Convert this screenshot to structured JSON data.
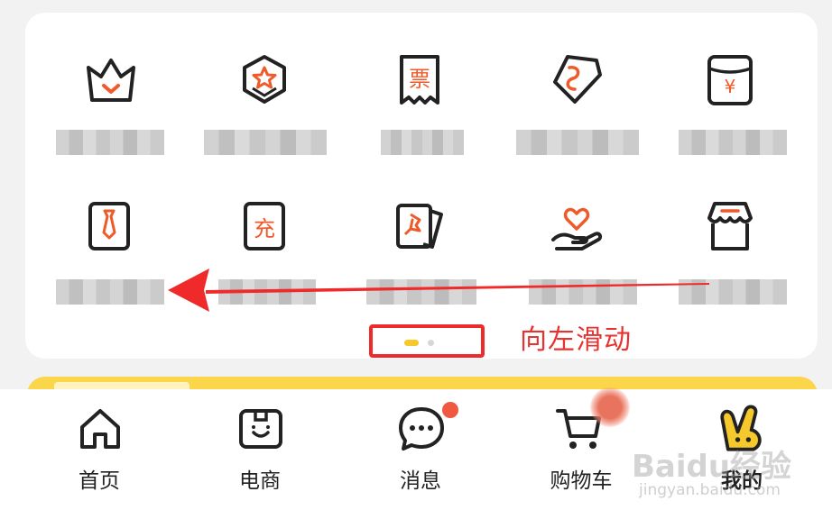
{
  "colors": {
    "accent_orange": "#ef5a2a",
    "icon_stroke": "#222222",
    "annotation_red": "#f02a2a",
    "pager_active": "#f5c92c",
    "pager_inactive": "#d6d6d6",
    "banner_yellow": "#fbd54a",
    "badge_red": "#f0593f"
  },
  "grid": {
    "items": [
      {
        "icon": "crown-icon"
      },
      {
        "icon": "star-badge-icon"
      },
      {
        "icon": "ticket-icon",
        "glyph": "票"
      },
      {
        "icon": "coupon-tag-icon"
      },
      {
        "icon": "red-envelope-icon",
        "glyph": "¥"
      },
      {
        "icon": "uniform-tie-icon"
      },
      {
        "icon": "recharge-icon",
        "glyph": "充"
      },
      {
        "icon": "pinned-cards-icon"
      },
      {
        "icon": "heart-hand-icon"
      },
      {
        "icon": "storefront-icon"
      }
    ]
  },
  "pager": {
    "pages": 2,
    "current": 1
  },
  "annotation": {
    "hint_text": "向左滑动"
  },
  "tabbar": {
    "tabs": [
      {
        "label": "首页",
        "icon": "home-icon"
      },
      {
        "label": "电商",
        "icon": "shop-box-icon"
      },
      {
        "label": "消息",
        "icon": "chat-bubble-icon"
      },
      {
        "label": "购物车",
        "icon": "shopping-cart-icon"
      },
      {
        "label": "我的",
        "icon": "mascot-ears-icon",
        "selected": true
      }
    ]
  },
  "watermark": {
    "brand": "Baidu经验",
    "url": "jingyan.baidu.com"
  }
}
